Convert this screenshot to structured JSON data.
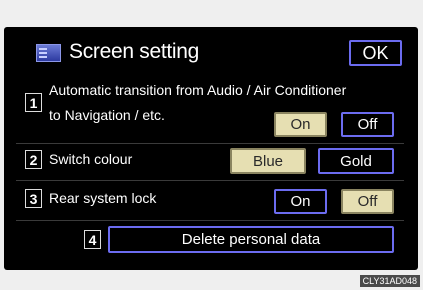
{
  "header": {
    "title": "Screen setting",
    "ok_label": "OK"
  },
  "rows": [
    {
      "number": "1",
      "label_line1": "Automatic transition from Audio / Air Conditioner",
      "label_line2": "to Navigation / etc.",
      "options": [
        "On",
        "Off"
      ],
      "selected": "On"
    },
    {
      "number": "2",
      "label_line1": "Switch colour",
      "options": [
        "Blue",
        "Gold"
      ],
      "selected": "Blue"
    },
    {
      "number": "3",
      "label_line1": "Rear system lock",
      "options": [
        "On",
        "Off"
      ],
      "selected": "Off"
    },
    {
      "number": "4",
      "action_label": "Delete personal data"
    }
  ],
  "image_code": "CLY31AD048",
  "colors": {
    "button_border": "#6c6cf0",
    "selected_fill": "#e6dfb2",
    "screen_bg": "#000000"
  },
  "icons": {
    "header": "screen-setting-icon"
  }
}
